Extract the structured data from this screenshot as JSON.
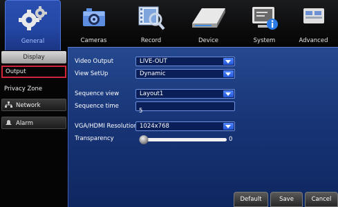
{
  "tabs": [
    {
      "label": "General",
      "icon": "gears-icon"
    },
    {
      "label": "Cameras",
      "icon": "camera-icon"
    },
    {
      "label": "Record",
      "icon": "record-icon"
    },
    {
      "label": "Device",
      "icon": "hard-drive-icon"
    },
    {
      "label": "System",
      "icon": "system-info-icon"
    },
    {
      "label": "Advanced",
      "icon": "advanced-icon"
    }
  ],
  "sidebar": {
    "display": "Display",
    "output": "Output",
    "privacy_zone": "Privacy Zone",
    "network": "Network",
    "alarm": "Alarm"
  },
  "form": {
    "video_output": {
      "label": "Video Output",
      "value": "LIVE-OUT"
    },
    "view_setup": {
      "label": "View SetUp",
      "value": "Dynamic"
    },
    "sequence_view": {
      "label": "Sequence view",
      "value": "Layout1"
    },
    "sequence_time": {
      "label": "Sequence time",
      "value": "5"
    },
    "resolution": {
      "label": "VGA/HDMI Resolution",
      "value": "1024x768"
    },
    "transparency": {
      "label": "Transparency",
      "value": "0",
      "level": 0
    }
  },
  "buttons": {
    "default": "Default",
    "save": "Save",
    "cancel": "Cancel"
  },
  "colors": {
    "accent": "#2a4fb0",
    "panel": "#183577",
    "selected_border": "#d4243a"
  }
}
